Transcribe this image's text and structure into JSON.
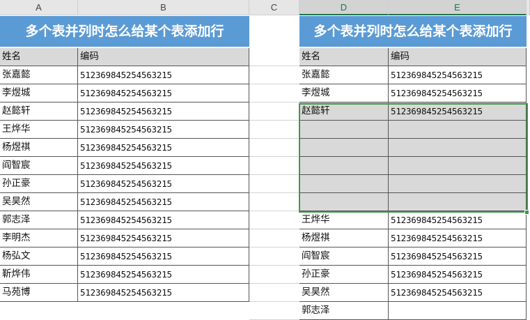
{
  "columns": {
    "a": "A",
    "b": "B",
    "c": "C",
    "d": "D",
    "e": "E"
  },
  "left_table": {
    "title": "多个表并列时怎么给某个表添加行",
    "headers": {
      "name": "姓名",
      "code": "编码"
    },
    "rows": [
      {
        "name": "张嘉懿",
        "code": "512369845254563215"
      },
      {
        "name": "李煜城",
        "code": "512369845254563215"
      },
      {
        "name": "赵懿轩",
        "code": "512369845254563215"
      },
      {
        "name": "王烨华",
        "code": "512369845254563215"
      },
      {
        "name": "杨煜祺",
        "code": "512369845254563215"
      },
      {
        "name": "阎智宸",
        "code": "512369845254563215"
      },
      {
        "name": "孙正豪",
        "code": "512369845254563215"
      },
      {
        "name": "吴昊然",
        "code": "512369845254563215"
      },
      {
        "name": "郭志泽",
        "code": "512369845254563215"
      },
      {
        "name": "李明杰",
        "code": "512369845254563215"
      },
      {
        "name": "杨弘文",
        "code": "512369845254563215"
      },
      {
        "name": "靳烨伟",
        "code": "512369845254563215"
      },
      {
        "name": "马苑博",
        "code": "512369845254563215"
      }
    ]
  },
  "right_table": {
    "title": "多个表并列时怎么给某个表添加行",
    "headers": {
      "name": "姓名",
      "code": "编码"
    },
    "rows": [
      {
        "name": "张嘉懿",
        "code": "512369845254563215"
      },
      {
        "name": "李煜城",
        "code": "512369845254563215"
      },
      {
        "name": "赵懿轩",
        "code": "512369845254563215"
      },
      {
        "name": "",
        "code": ""
      },
      {
        "name": "",
        "code": ""
      },
      {
        "name": "",
        "code": ""
      },
      {
        "name": "",
        "code": ""
      },
      {
        "name": "",
        "code": ""
      },
      {
        "name": "王烨华",
        "code": "512369845254563215"
      },
      {
        "name": "杨煜祺",
        "code": "512369845254563215"
      },
      {
        "name": "阎智宸",
        "code": "512369845254563215"
      },
      {
        "name": "孙正豪",
        "code": "512369845254563215"
      },
      {
        "name": "吴昊然",
        "code": "512369845254563215"
      },
      {
        "name": "郭志泽",
        "code": ""
      }
    ]
  },
  "colors": {
    "title_bg": "#5b9bd5",
    "selection": "#3c9a48",
    "gray": "#d9d9d9"
  }
}
